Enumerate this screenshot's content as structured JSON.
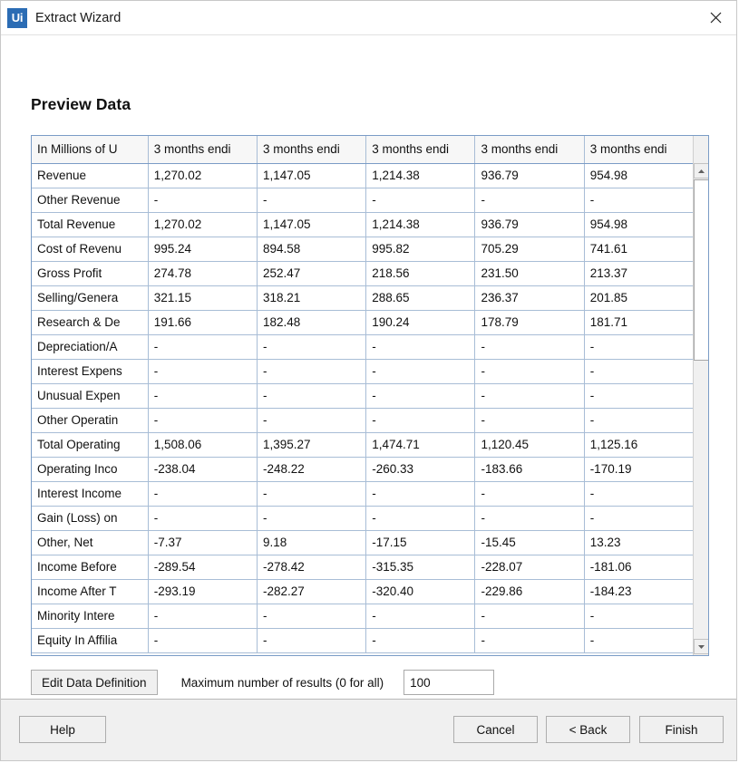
{
  "window": {
    "title": "Extract Wizard",
    "logo_text": "Ui",
    "logo_color": "#2b6cb4",
    "close_icon": "close-icon"
  },
  "page": {
    "title": "Preview Data"
  },
  "grid": {
    "columns": [
      "In Millions of U",
      "3 months endi",
      "3 months endi",
      "3 months endi",
      "3 months endi",
      "3 months endi"
    ],
    "rows": [
      {
        "label": "Revenue",
        "values": [
          "1,270.02",
          "1,147.05",
          "1,214.38",
          "936.79",
          "954.98"
        ]
      },
      {
        "label": "Other Revenue",
        "values": [
          "-",
          "-",
          "-",
          "-",
          "-"
        ]
      },
      {
        "label": "Total Revenue",
        "values": [
          "1,270.02",
          "1,147.05",
          "1,214.38",
          "936.79",
          "954.98"
        ]
      },
      {
        "label": "Cost of Revenu",
        "values": [
          "995.24",
          "894.58",
          "995.82",
          "705.29",
          "741.61"
        ]
      },
      {
        "label": "Gross Profit",
        "values": [
          "274.78",
          "252.47",
          "218.56",
          "231.50",
          "213.37"
        ]
      },
      {
        "label": "Selling/Genera",
        "values": [
          "321.15",
          "318.21",
          "288.65",
          "236.37",
          "201.85"
        ]
      },
      {
        "label": "Research & De",
        "values": [
          "191.66",
          "182.48",
          "190.24",
          "178.79",
          "181.71"
        ]
      },
      {
        "label": "Depreciation/A",
        "values": [
          "-",
          "-",
          "-",
          "-",
          "-"
        ]
      },
      {
        "label": "Interest Expens",
        "values": [
          "-",
          "-",
          "-",
          "-",
          "-"
        ]
      },
      {
        "label": "Unusual Expen",
        "values": [
          "-",
          "-",
          "-",
          "-",
          "-"
        ]
      },
      {
        "label": "Other Operatin",
        "values": [
          "-",
          "-",
          "-",
          "-",
          "-"
        ]
      },
      {
        "label": "Total Operating",
        "values": [
          "1,508.06",
          "1,395.27",
          "1,474.71",
          "1,120.45",
          "1,125.16"
        ]
      },
      {
        "label": "Operating Inco",
        "values": [
          "-238.04",
          "-248.22",
          "-260.33",
          "-183.66",
          "-170.19"
        ]
      },
      {
        "label": "Interest Income",
        "values": [
          "-",
          "-",
          "-",
          "-",
          "-"
        ]
      },
      {
        "label": "Gain (Loss) on",
        "values": [
          "-",
          "-",
          "-",
          "-",
          "-"
        ]
      },
      {
        "label": "Other, Net",
        "values": [
          "-7.37",
          "9.18",
          "-17.15",
          "-15.45",
          "13.23"
        ]
      },
      {
        "label": "Income Before",
        "values": [
          "-289.54",
          "-278.42",
          "-315.35",
          "-228.07",
          "-181.06"
        ]
      },
      {
        "label": "Income After T",
        "values": [
          "-293.19",
          "-282.27",
          "-320.40",
          "-229.86",
          "-184.23"
        ]
      },
      {
        "label": "Minority Intere",
        "values": [
          "-",
          "-",
          "-",
          "-",
          "-"
        ]
      },
      {
        "label": "Equity In Affilia",
        "values": [
          "-",
          "-",
          "-",
          "-",
          "-"
        ]
      }
    ]
  },
  "options": {
    "edit_data_definition_label": "Edit Data Definition",
    "max_results_label": "Maximum number of results (0 for all)",
    "max_results_value": "100"
  },
  "footer": {
    "help_label": "Help",
    "cancel_label": "Cancel",
    "back_label": "< Back",
    "finish_label": "Finish"
  }
}
